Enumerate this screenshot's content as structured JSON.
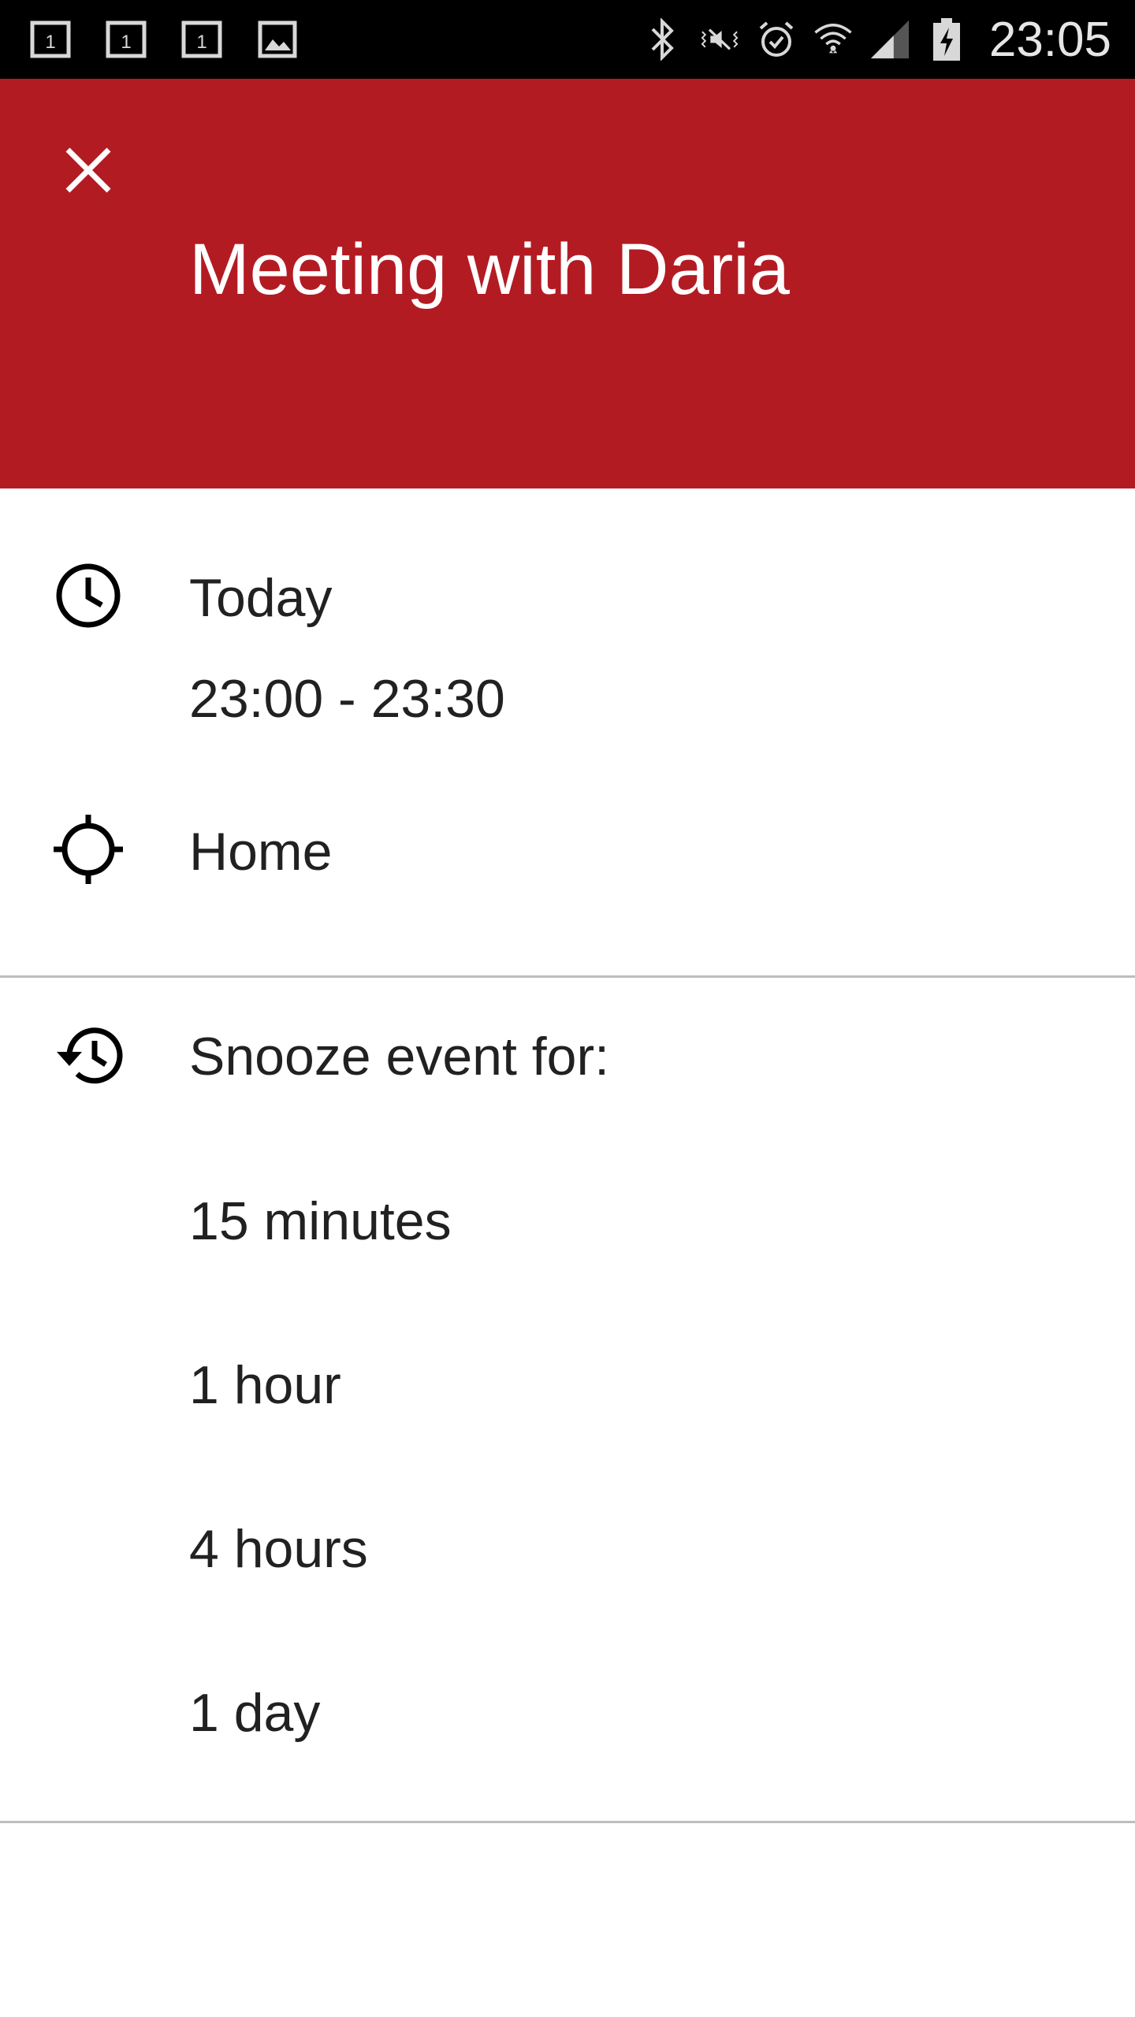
{
  "status_bar": {
    "time": "23:05",
    "left_icons": [
      "calendar-notification-icon",
      "calendar-notification-icon",
      "calendar-notification-icon",
      "image-notification-icon"
    ],
    "right_icons": [
      "bluetooth-icon",
      "vibrate-icon",
      "alarm-icon",
      "wifi-icon",
      "signal-icon",
      "battery-charging-icon"
    ]
  },
  "header": {
    "background": "#b31b23",
    "close_icon": "close-icon",
    "title": "Meeting with Daria"
  },
  "event": {
    "date": "Today",
    "time_range": "23:00 - 23:30",
    "location": "Home"
  },
  "snooze": {
    "label": "Snooze event for:",
    "options": [
      "15 minutes",
      "1 hour",
      "4 hours",
      "1 day"
    ]
  }
}
